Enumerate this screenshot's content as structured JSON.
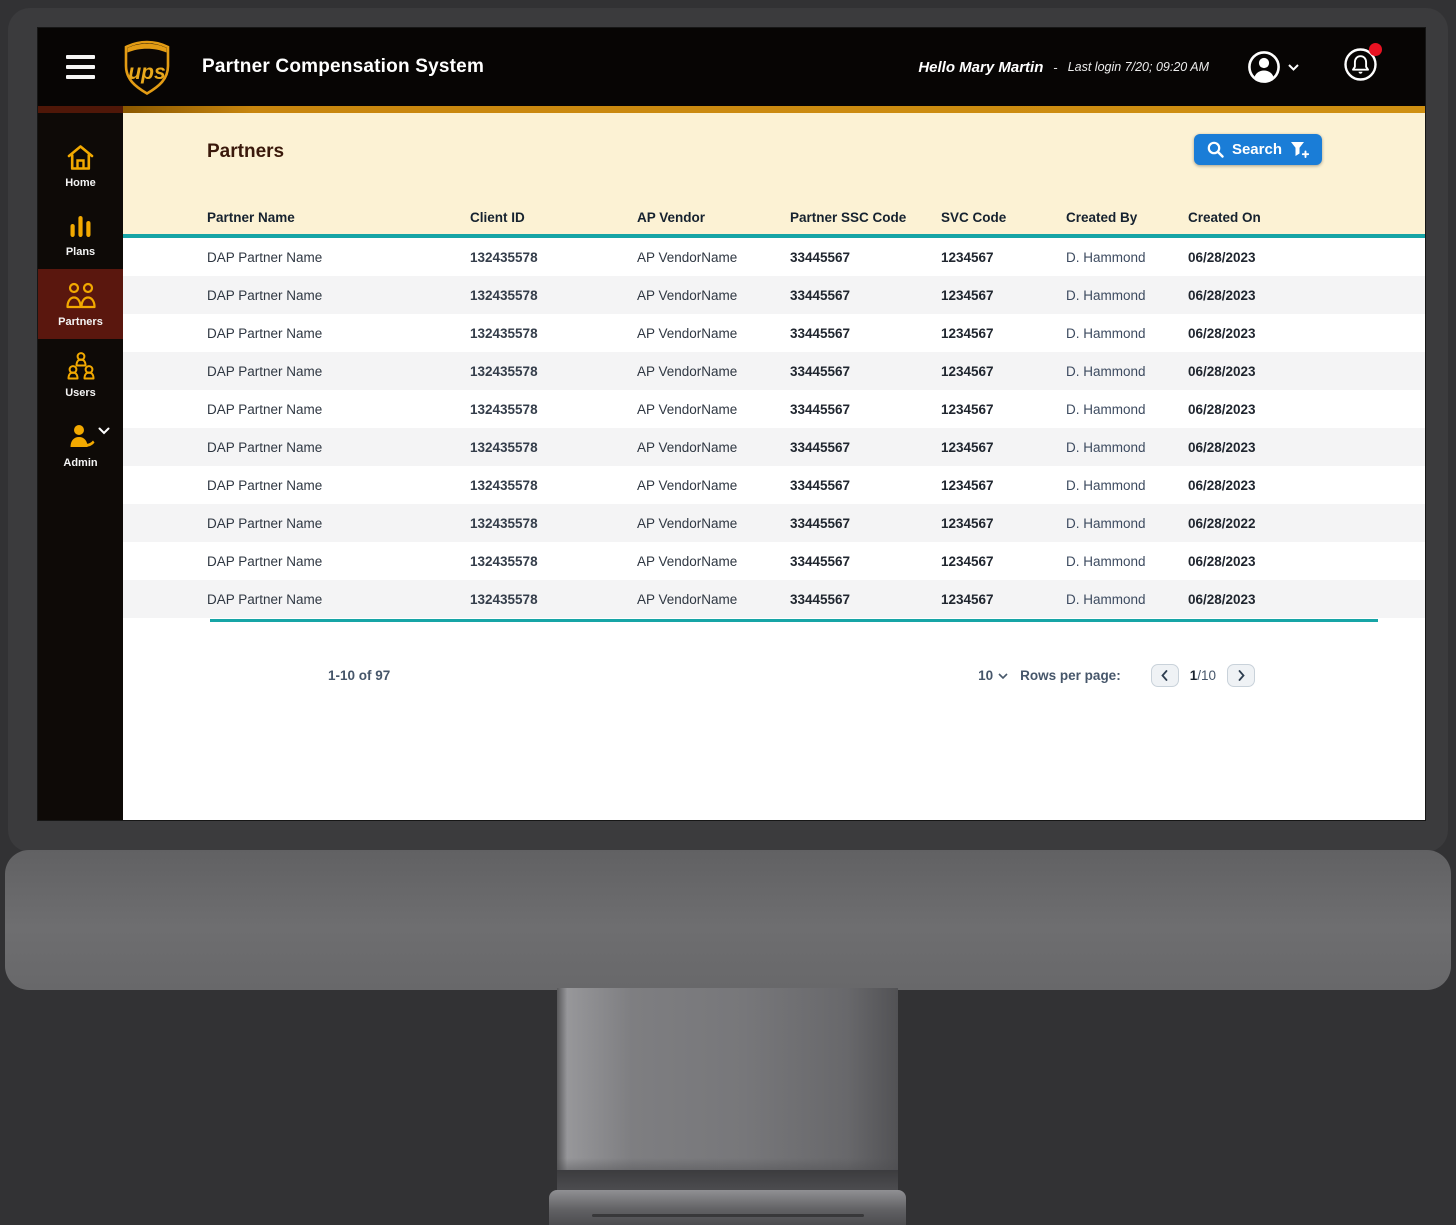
{
  "topbar": {
    "title": "Partner Compensation System",
    "greeting": "Hello Mary Martin",
    "separator": "-",
    "last_login": "Last login 7/20; 09:20 AM"
  },
  "sidebar": {
    "items": [
      {
        "label": "Home",
        "icon": "home-icon",
        "active": false
      },
      {
        "label": "Plans",
        "icon": "bar-chart-icon",
        "active": false
      },
      {
        "label": "Partners",
        "icon": "partners-icon",
        "active": true
      },
      {
        "label": "Users",
        "icon": "users-icon",
        "active": false
      },
      {
        "label": "Admin",
        "icon": "admin-icon",
        "active": false,
        "has_chevron": true
      }
    ]
  },
  "page": {
    "title": "Partners",
    "search_button": "Search"
  },
  "table": {
    "columns": [
      "Partner Name",
      "Client ID",
      "AP Vendor",
      "Partner SSC Code",
      "SVC Code",
      "Created By",
      "Created On"
    ],
    "rows": [
      [
        "DAP Partner Name",
        "132435578",
        "AP VendorName",
        "33445567",
        "1234567",
        "D. Hammond",
        "06/28/2023"
      ],
      [
        "DAP Partner Name",
        "132435578",
        "AP VendorName",
        "33445567",
        "1234567",
        "D. Hammond",
        "06/28/2023"
      ],
      [
        "DAP Partner Name",
        "132435578",
        "AP VendorName",
        "33445567",
        "1234567",
        "D. Hammond",
        "06/28/2023"
      ],
      [
        "DAP Partner Name",
        "132435578",
        "AP VendorName",
        "33445567",
        "1234567",
        "D. Hammond",
        "06/28/2023"
      ],
      [
        "DAP Partner Name",
        "132435578",
        "AP VendorName",
        "33445567",
        "1234567",
        "D. Hammond",
        "06/28/2023"
      ],
      [
        "DAP Partner Name",
        "132435578",
        "AP VendorName",
        "33445567",
        "1234567",
        "D. Hammond",
        "06/28/2023"
      ],
      [
        "DAP Partner Name",
        "132435578",
        "AP VendorName",
        "33445567",
        "1234567",
        "D. Hammond",
        "06/28/2023"
      ],
      [
        "DAP Partner Name",
        "132435578",
        "AP VendorName",
        "33445567",
        "1234567",
        "D. Hammond",
        "06/28/2022"
      ],
      [
        "DAP Partner Name",
        "132435578",
        "AP VendorName",
        "33445567",
        "1234567",
        "D. Hammond",
        "06/28/2023"
      ],
      [
        "DAP Partner Name",
        "132435578",
        "AP VendorName",
        "33445567",
        "1234567",
        "D. Hammond",
        "06/28/2023"
      ]
    ]
  },
  "pagination": {
    "range": "1-10 of 97",
    "rows_per_page_value": "10",
    "rows_per_page_label": "Rows per page:",
    "current_page": "1",
    "total_pages": "/10"
  },
  "colors": {
    "ups_gold": "#F2A900",
    "teal": "#17A5A6",
    "search_blue": "#1A7DD7",
    "cream": "#FCF2D4",
    "active_maroon": "#5A170E",
    "accent_gold_strip": "#C8860E",
    "accent_maroon_strip": "#4F1708",
    "notification_red": "#E81222"
  }
}
